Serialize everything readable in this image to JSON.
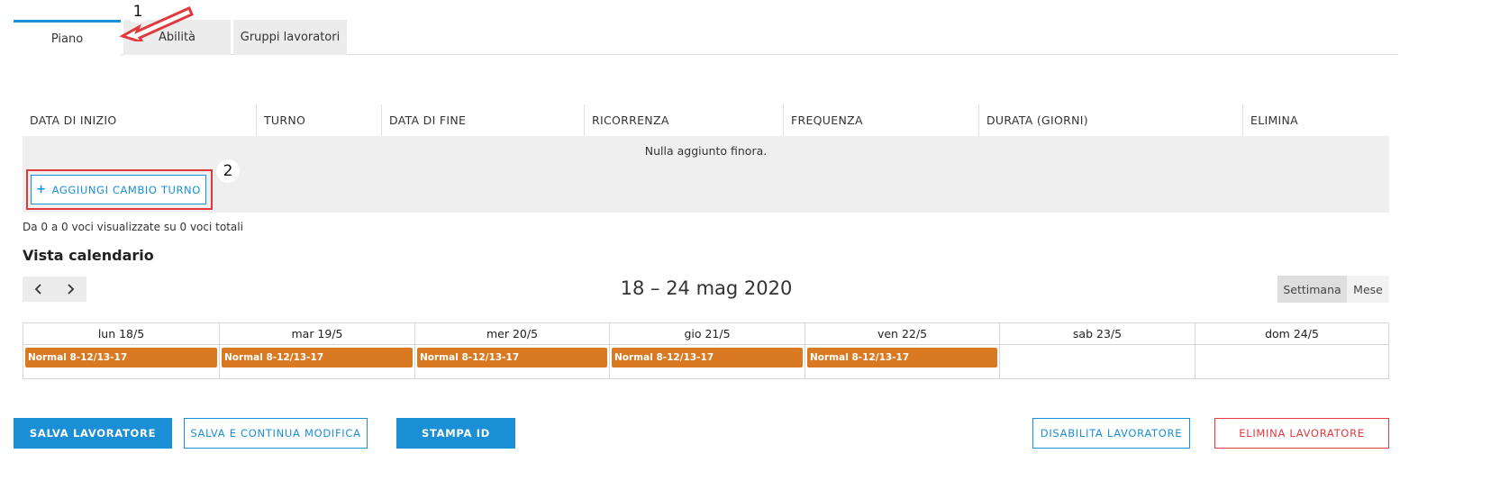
{
  "tabs": [
    {
      "label": "Piano",
      "active": true
    },
    {
      "label": "Abilità",
      "active": false
    },
    {
      "label": "Gruppi lavoratori",
      "active": false
    }
  ],
  "annotations": {
    "badge_1": "1",
    "badge_2": "2"
  },
  "table": {
    "columns": [
      "DATA DI INIZIO",
      "TURNO",
      "DATA DI FINE",
      "RICORRENZA",
      "FREQUENZA",
      "DURATA (GIORNI)",
      "ELIMINA"
    ],
    "empty_message": "Nulla aggiunto finora.",
    "add_button_label": "AGGIUNGI CAMBIO TURNO",
    "count_text": "Da 0 a 0 voci visualizzate su 0 voci totali"
  },
  "calendar": {
    "title": "Vista calendario",
    "date_range": "18 – 24 mag 2020",
    "views": [
      {
        "label": "Settimana",
        "selected": true
      },
      {
        "label": "Mese",
        "selected": false
      }
    ],
    "days": [
      {
        "label": "lun 18/5",
        "event": "Normal 8-12/13-17"
      },
      {
        "label": "mar 19/5",
        "event": "Normal 8-12/13-17"
      },
      {
        "label": "mer 20/5",
        "event": "Normal 8-12/13-17"
      },
      {
        "label": "gio 21/5",
        "event": "Normal 8-12/13-17"
      },
      {
        "label": "ven 22/5",
        "event": "Normal 8-12/13-17"
      },
      {
        "label": "sab 23/5",
        "event": null
      },
      {
        "label": "dom 24/5",
        "event": null
      }
    ],
    "event_color": "#d97a22"
  },
  "footer": {
    "save": "SALVA LAVORATORE",
    "save_continue": "SALVA E CONTINUA MODIFICA",
    "print_id": "STAMPA ID",
    "disable": "DISABILITA LAVORATORE",
    "delete": "ELIMINA LAVORATORE"
  },
  "colors": {
    "accent": "#1a8fd6",
    "danger": "#e0393e",
    "annotation": "#e0393e"
  },
  "icons": [
    "arrow-annotation-icon",
    "plus-icon",
    "chevron-left-icon",
    "chevron-right-icon"
  ]
}
